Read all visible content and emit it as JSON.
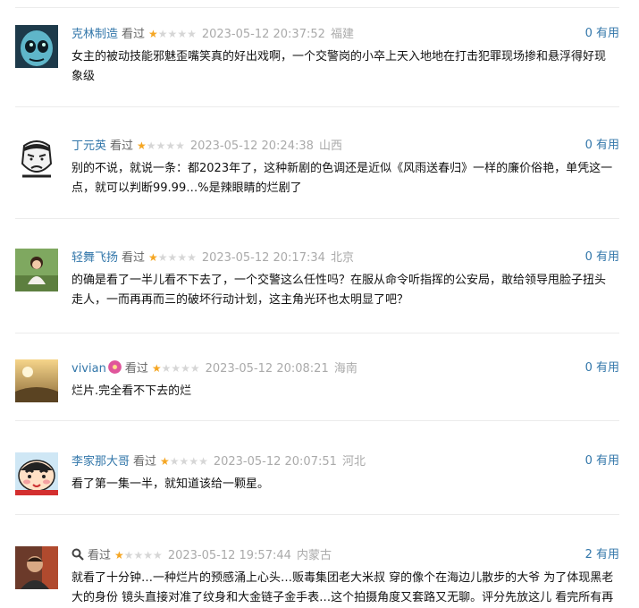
{
  "vote_suffix": "有用",
  "watched_label": "看过",
  "comments": [
    {
      "user": "克林制造",
      "status": "看过",
      "rating_stars": 1,
      "time": "2023-05-12 20:37:52",
      "location": "福建",
      "votes": "0",
      "vote_label": "有用",
      "content": "女主的被动技能邪魅歪嘴笑真的好出戏啊，一个交警岗的小卒上天入地地在打击犯罪现场掺和悬浮得好现象级",
      "avatar": "blue-alien-avatar"
    },
    {
      "user": "丁元英",
      "status": "看过",
      "rating_stars": 1,
      "time": "2023-05-12 20:24:38",
      "location": "山西",
      "votes": "0",
      "vote_label": "有用",
      "content": "别的不说，就说一条：都2023年了，这种新剧的色调还是近似《风雨送春归》一样的廉价俗艳，单凭这一点，就可以判断99.99…%是辣眼睛的烂剧了",
      "avatar": "meme-face-avatar"
    },
    {
      "user": "轻舞飞扬",
      "status": "看过",
      "rating_stars": 1,
      "time": "2023-05-12 20:17:34",
      "location": "北京",
      "votes": "0",
      "vote_label": "有用",
      "content": "的确是看了一半儿看不下去了，一个交警这么任性吗？在服从命令听指挥的公安局，敢给领导甩脸子扭头走人，一而再再而三的破坏行动计划，这主角光环也太明显了吧？",
      "avatar": "girl-garden-avatar"
    },
    {
      "user": "vivian",
      "status": "看过",
      "rating_stars": 1,
      "time": "2023-05-12 20:08:21",
      "location": "海南",
      "votes": "0",
      "vote_label": "有用",
      "content": "烂片.完全看不下去的烂",
      "avatar": "sunset-avatar"
    },
    {
      "user": "李家那大哥",
      "status": "看过",
      "rating_stars": 1,
      "time": "2023-05-12 20:07:51",
      "location": "河北",
      "votes": "0",
      "vote_label": "有用",
      "content": "看了第一集一半，就知道该给一颗星。",
      "avatar": "crayon-shin-avatar"
    },
    {
      "user": "",
      "status": "看过",
      "rating_stars": 1,
      "time": "2023-05-12 19:57:44",
      "location": "内蒙古",
      "votes": "2",
      "vote_label": "有用",
      "content": "就看了十分钟…一种烂片的预感涌上心头…贩毒集团老大米叔 穿的像个在海边儿散步的大爷 为了体现黑老大的身份 镜头直接对准了纹身和大金链子金手表…这个拍摄角度又套路又无聊。评分先放这儿 看完所有再",
      "avatar": "man-portrait-avatar"
    }
  ]
}
